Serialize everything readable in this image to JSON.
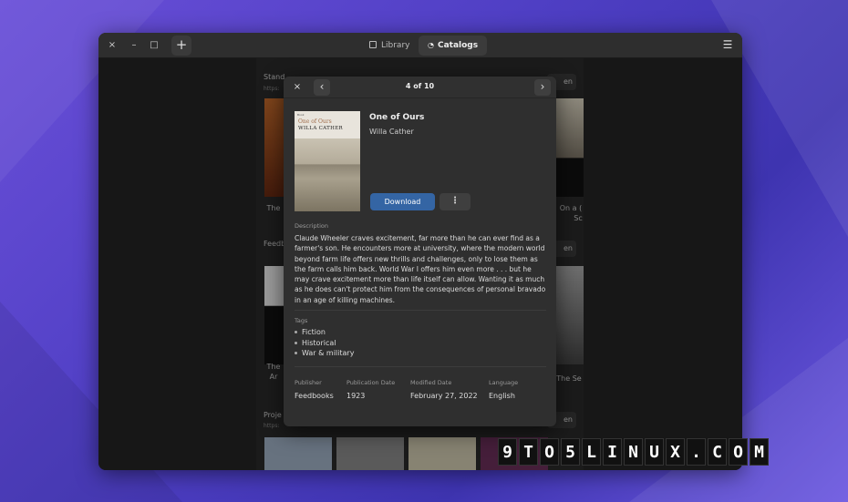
{
  "header": {
    "close_icon": "×",
    "minimize_icon": "–",
    "maximize_icon": "□",
    "add_icon": "+",
    "menu_icon": "☰",
    "tabs": [
      {
        "label": "Library",
        "icon": "library-icon",
        "active": false
      },
      {
        "label": "Catalogs",
        "icon": "rss-icon",
        "active": true
      }
    ]
  },
  "background_list": {
    "sections": [
      {
        "title": "Stand",
        "url": "https:",
        "open_label": "en"
      },
      {
        "title": "Feedb",
        "url": "https:",
        "open_label": "en"
      },
      {
        "title": "Proje",
        "url": "https:",
        "open_label": "en"
      }
    ],
    "left_captions": [
      "The",
      "The",
      "Ar"
    ],
    "right_captions": [
      "On a (",
      "Sc",
      "The Se"
    ]
  },
  "dialog": {
    "close_icon": "×",
    "prev_icon": "‹",
    "next_icon": "›",
    "counter": "4 of 10",
    "book": {
      "title": "One of Ours",
      "author": "Willa Cather",
      "cover_title": "One of Ours",
      "cover_author": "WILLA CATHER",
      "cover_publisher": "Book"
    },
    "download_label": "Download",
    "more_icon": "⋮",
    "description_label": "Description",
    "description": "Claude Wheeler craves excitement, far more than he can ever find as a farmer's son. He encounters more at university, where the modern world beyond farm life offers new thrills and challenges, only to lose them as the farm calls him back. World War I offers him even more . . . but he may crave excitement more than life itself can allow. Wanting it as much as he does can't protect him from the consequences of personal bravado in an age of killing machines.",
    "tags_label": "Tags",
    "tags": [
      "Fiction",
      "Historical",
      "War & military"
    ],
    "meta": {
      "publisher_label": "Publisher",
      "publisher": "Feedbooks",
      "pubdate_label": "Publication Date",
      "pubdate": "1923",
      "modified_label": "Modified Date",
      "modified": "February 27, 2022",
      "language_label": "Language",
      "language": "English"
    }
  },
  "watermark": [
    "9",
    "T",
    "O",
    "5",
    "L",
    "I",
    "N",
    "U",
    "X",
    ".",
    "C",
    "O",
    "M"
  ],
  "colors": {
    "accent": "#3465a4",
    "window_bg": "#242424",
    "dialog_bg": "#2f2f2f"
  }
}
